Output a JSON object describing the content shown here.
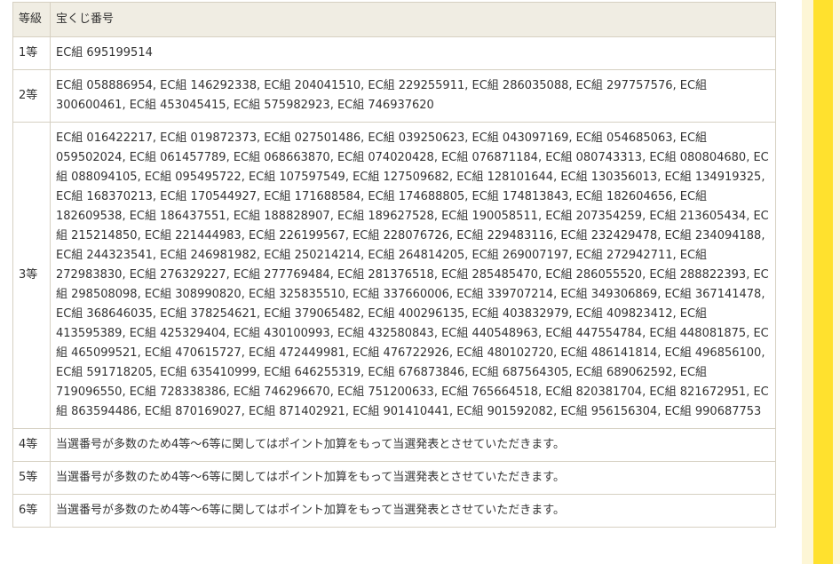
{
  "table": {
    "header": {
      "grade": "等級",
      "numbers": "宝くじ番号"
    },
    "rows": [
      {
        "grade": "1等",
        "text": "EC組 695199514"
      },
      {
        "grade": "2等",
        "text": "EC組 058886954, EC組 146292338, EC組 204041510, EC組 229255911, EC組 286035088, EC組 297757576, EC組 300600461, EC組 453045415, EC組 575982923, EC組 746937620"
      },
      {
        "grade": "3等",
        "text": "EC組 016422217, EC組 019872373, EC組 027501486, EC組 039250623, EC組 043097169, EC組 054685063, EC組 059502024, EC組 061457789, EC組 068663870, EC組 074020428, EC組 076871184, EC組 080743313, EC組 080804680, EC組 088094105, EC組 095495722, EC組 107597549, EC組 127509682, EC組 128101644, EC組 130356013, EC組 134919325, EC組 168370213, EC組 170544927, EC組 171688584, EC組 174688805, EC組 174813843, EC組 182604656, EC組 182609538, EC組 186437551, EC組 188828907, EC組 189627528, EC組 190058511, EC組 207354259, EC組 213605434, EC組 215214850, EC組 221444983, EC組 226199567, EC組 228076726, EC組 229483116, EC組 232429478, EC組 234094188, EC組 244323541, EC組 246981982, EC組 250214214, EC組 264814205, EC組 269007197, EC組 272942711, EC組 272983830, EC組 276329227, EC組 277769484, EC組 281376518, EC組 285485470, EC組 286055520, EC組 288822393, EC組 298508098, EC組 308990820, EC組 325835510, EC組 337660006, EC組 339707214, EC組 349306869, EC組 367141478, EC組 368646035, EC組 378254621, EC組 379065482, EC組 400296135, EC組 403832979, EC組 409823412, EC組 413595389, EC組 425329404, EC組 430100993, EC組 432580843, EC組 440548963, EC組 447554784, EC組 448081875, EC組 465099521, EC組 470615727, EC組 472449981, EC組 476722926, EC組 480102720, EC組 486141814, EC組 496856100, EC組 591718205, EC組 635410999, EC組 646255319, EC組 676873846, EC組 687564305, EC組 689062592, EC組 719096550, EC組 728338386, EC組 746296670, EC組 751200633, EC組 765664518, EC組 820381704, EC組 821672951, EC組 863594486, EC組 870169027, EC組 871402921, EC組 901410441, EC組 901592082, EC組 956156304, EC組 990687753"
      },
      {
        "grade": "4等",
        "text": "当選番号が多数のため4等〜6等に関してはポイント加算をもって当選発表とさせていただきます。"
      },
      {
        "grade": "5等",
        "text": "当選番号が多数のため4等〜6等に関してはポイント加算をもって当選発表とさせていただきます。"
      },
      {
        "grade": "6等",
        "text": "当選番号が多数のため4等〜6等に関してはポイント加算をもって当選発表とさせていただきます。"
      }
    ]
  },
  "colors": {
    "header_background": "#f0ede3",
    "border": "#d6d0c2",
    "side_panel": "#fdf6d6",
    "side_bar": "#ffe12e"
  }
}
